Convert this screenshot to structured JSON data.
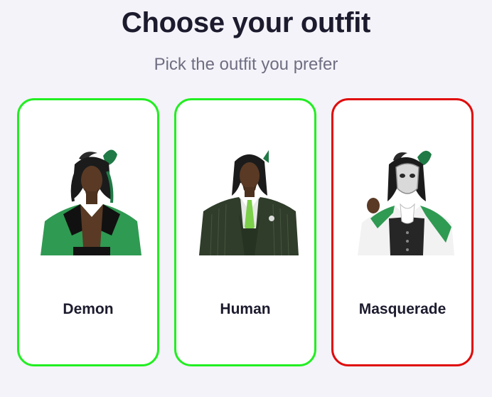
{
  "header": {
    "title": "Choose your outfit",
    "subtitle": "Pick the outfit you prefer"
  },
  "outfits": [
    {
      "label": "Demon",
      "portrait": "demon-outfit-portrait",
      "selected": false
    },
    {
      "label": "Human",
      "portrait": "human-suit-portrait",
      "selected": false
    },
    {
      "label": "Masquerade",
      "portrait": "masquerade-mask-portrait",
      "selected": true
    }
  ],
  "colors": {
    "background": "#f4f3f9",
    "card_border_default": "#22ee22",
    "card_border_selected": "#e00b0b",
    "title": "#1c1b2e",
    "subtitle": "#6f6e82",
    "accent_green": "#2f9a52"
  }
}
